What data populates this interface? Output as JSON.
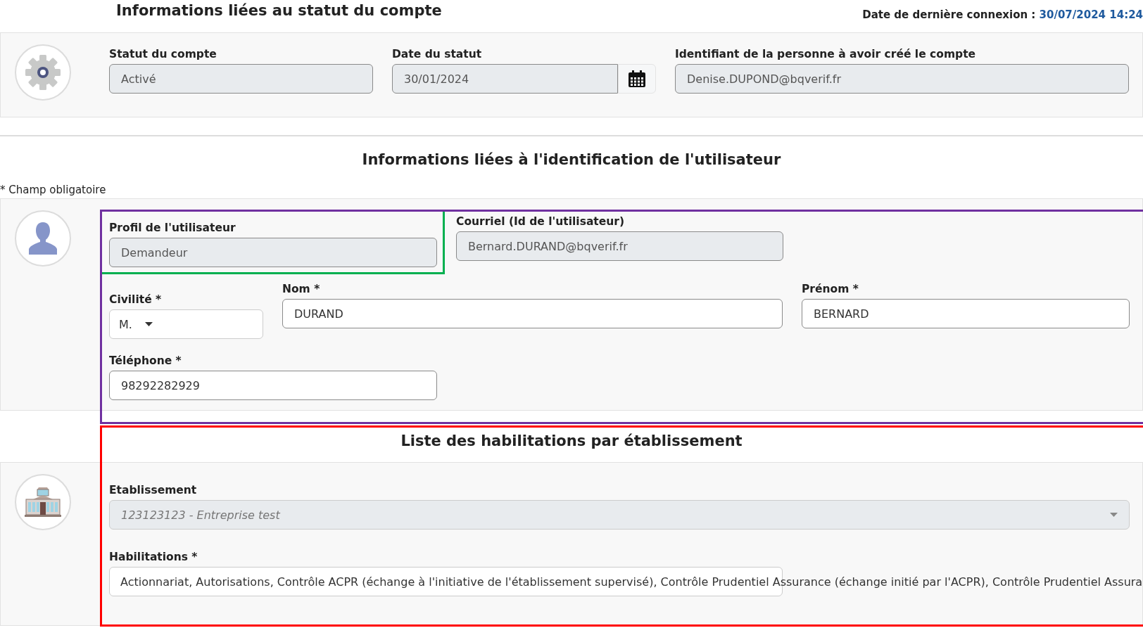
{
  "header": {
    "title": "Informations liées au statut du compte",
    "last_login_label": "Date de dernière connexion :",
    "last_login_value": "30/07/2024 14:24"
  },
  "account_status": {
    "fields": [
      {
        "label": "Statut du compte",
        "value": "Activé",
        "kind": "readonly"
      },
      {
        "label": "Date du statut",
        "value": "30/01/2024",
        "kind": "date"
      },
      {
        "label": "Identifiant de la personne à avoir créé le compte",
        "value": "Denise.DUPOND@bqverif.fr",
        "kind": "readonly"
      }
    ]
  },
  "identification": {
    "title": "Informations liées à l'identification de l'utilisateur",
    "required_note": "* Champ obligatoire",
    "rows": [
      [
        {
          "label": "Profil de l'utilisateur",
          "value": "Demandeur",
          "kind": "readonly"
        },
        {
          "label": "Courriel (Id de l'utilisateur)",
          "value": "Bernard.DURAND@bqverif.fr",
          "kind": "readonly"
        }
      ],
      [
        {
          "label": "Civilité *",
          "value": "M.",
          "kind": "select"
        },
        {
          "label": "Nom *",
          "value": "DURAND",
          "kind": "text"
        },
        {
          "label": "Prénom *",
          "value": "BERNARD",
          "kind": "text"
        }
      ],
      [
        {
          "label": "Téléphone *",
          "value": "98292282929",
          "kind": "text"
        }
      ]
    ]
  },
  "habilitations": {
    "title": "Liste des habilitations par établissement",
    "fields": [
      {
        "label": "Etablissement",
        "value": "123123123 - Entreprise test",
        "kind": "readonly_select"
      },
      {
        "label": "Habilitations *",
        "value": "Actionnariat, Autorisations, Contrôle ACPR (échange à l'initiative de l'établissement supervisé), Contrôle Prudentiel Assurance (échange initié par l'ACPR), Contrôle Prudentiel Assura",
        "kind": "overflow_text"
      }
    ]
  },
  "highlights": [
    {
      "color": "#00b050"
    },
    {
      "color": "#7030a0"
    },
    {
      "color": "#ff0000"
    }
  ]
}
